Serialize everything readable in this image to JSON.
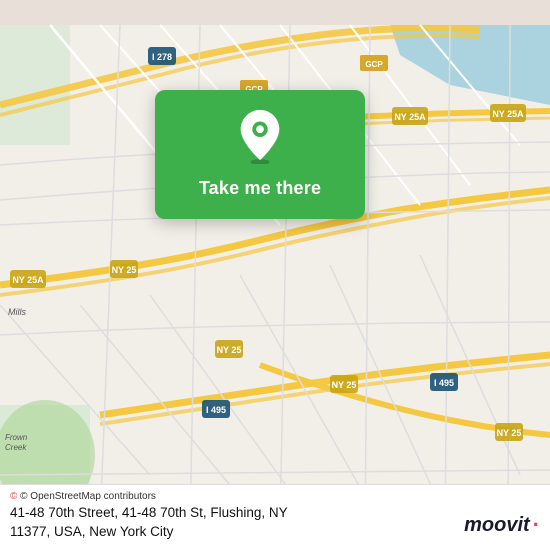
{
  "map": {
    "background_color": "#e8e0d8",
    "alt": "Map of Flushing, NY area"
  },
  "card": {
    "background_color": "#3db04b",
    "button_label": "Take me there"
  },
  "bottom": {
    "attribution": "© OpenStreetMap contributors",
    "address_line1": "41-48 70th Street, 41-48 70th St, Flushing, NY",
    "address_line2": "11377, USA, New York City"
  },
  "moovit": {
    "logo_text": "moovit"
  }
}
